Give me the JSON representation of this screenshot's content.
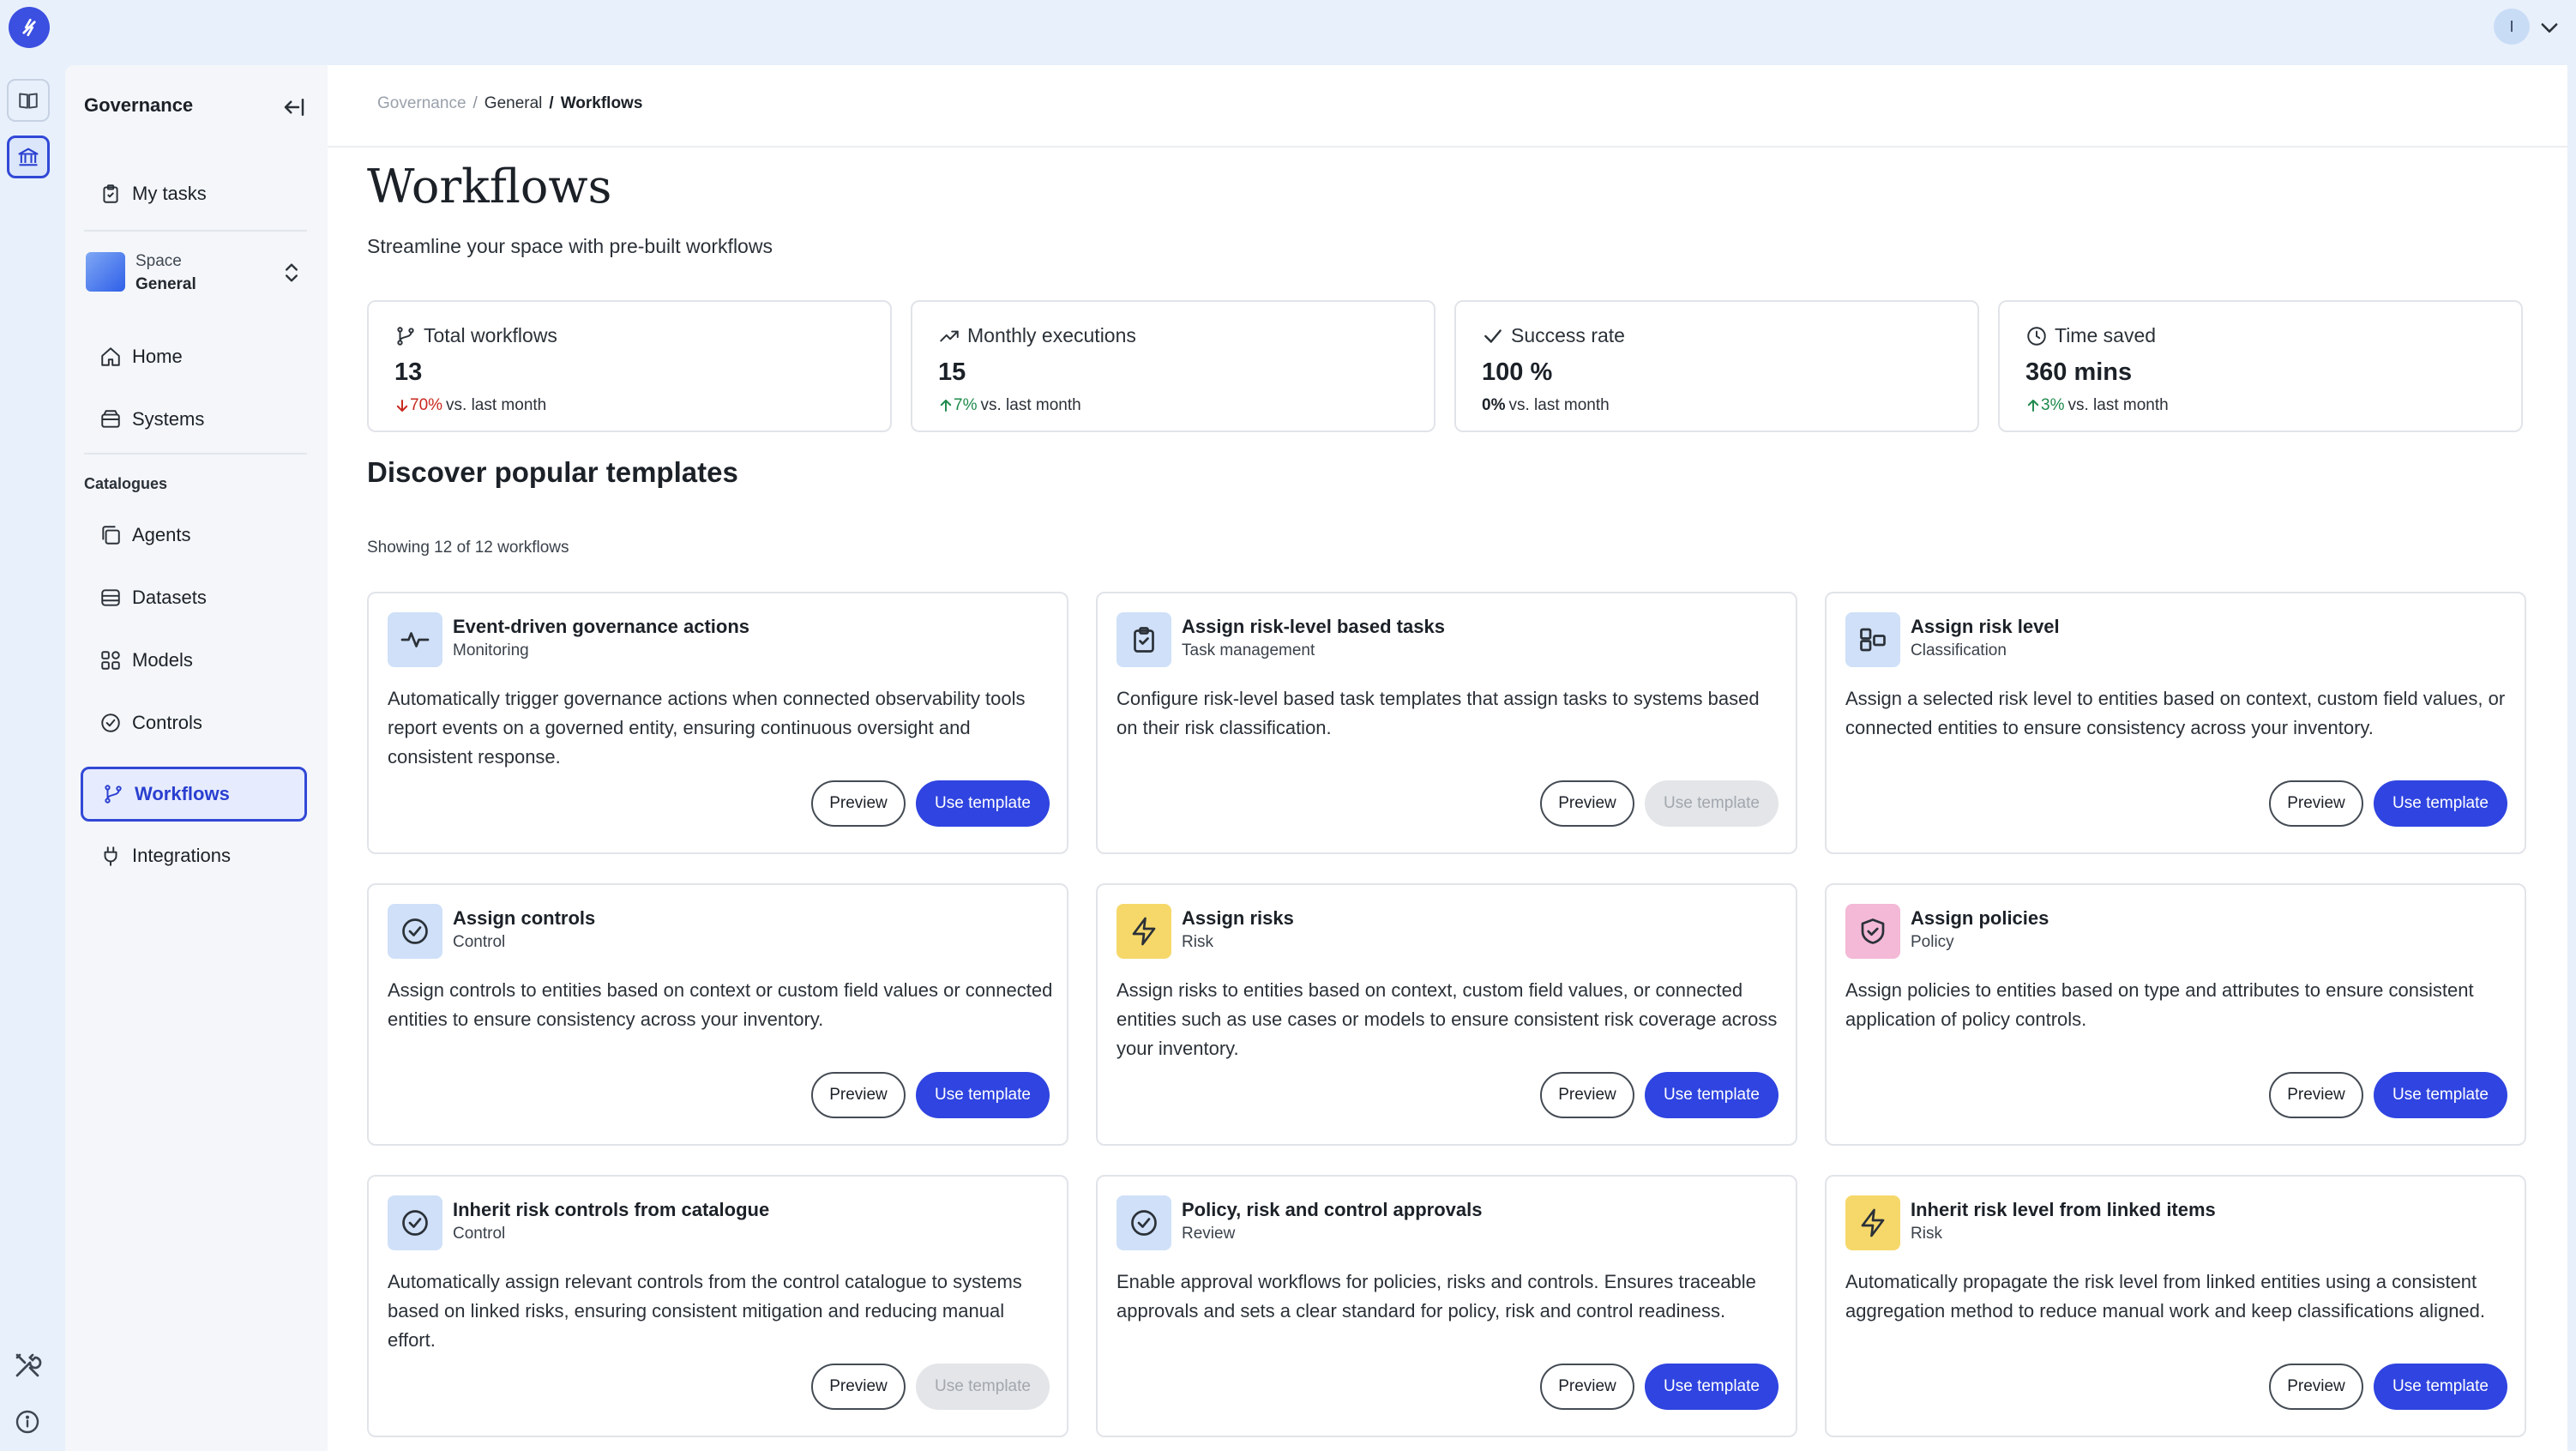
{
  "user": {
    "initial": "I"
  },
  "sidebar": {
    "title": "Governance",
    "my_tasks": "My tasks",
    "space_label": "Space",
    "space_name": "General",
    "home": "Home",
    "systems": "Systems",
    "catalogues_header": "Catalogues",
    "agents": "Agents",
    "datasets": "Datasets",
    "models": "Models",
    "controls": "Controls",
    "workflows": "Workflows",
    "integrations": "Integrations"
  },
  "breadcrumb": {
    "root": "Governance",
    "separator": "/",
    "mid": "General",
    "current": "Workflows"
  },
  "page": {
    "title": "Workflows",
    "subtitle": "Streamline your space with pre-built workflows"
  },
  "stats": [
    {
      "label": "Total workflows",
      "value": "13",
      "change": "70%",
      "direction": "down",
      "suffix": "vs. last month"
    },
    {
      "label": "Monthly executions",
      "value": "15",
      "change": "7%",
      "direction": "up",
      "suffix": "vs. last month"
    },
    {
      "label": "Success rate",
      "value": "100 %",
      "change": "0%",
      "direction": "flat",
      "suffix": "vs. last month"
    },
    {
      "label": "Time saved",
      "value": "360 mins",
      "change": "3%",
      "direction": "up",
      "suffix": "vs. last month"
    }
  ],
  "templates_section": {
    "title": "Discover popular templates",
    "showing": "Showing 12 of 12 workflows"
  },
  "buttons": {
    "preview": "Preview",
    "use": "Use template"
  },
  "colors": {
    "accent": "#2f44e0",
    "icon_blue": "#cfe0f8",
    "icon_yellow": "#f6d86a",
    "icon_pink": "#f3b9d6",
    "down": "#c8281e",
    "up": "#1e8a4c"
  },
  "templates": [
    {
      "title": "Event-driven governance actions",
      "category": "Monitoring",
      "icon": "pulse-icon",
      "icon_color": "blue",
      "description": "Automatically trigger governance actions when connected observability tools report events on a governed entity, ensuring continuous oversight and consistent response.",
      "use_enabled": true
    },
    {
      "title": "Assign risk-level based tasks",
      "category": "Task management",
      "icon": "clipboard-check-icon",
      "icon_color": "blue",
      "description": "Configure risk-level based task templates that assign tasks to systems based on their risk classification.",
      "use_enabled": false
    },
    {
      "title": "Assign risk level",
      "category": "Classification",
      "icon": "classification-icon",
      "icon_color": "blue",
      "description": "Assign a selected risk level to entities based on context, custom field values, or connected entities to ensure consistency across your inventory.",
      "use_enabled": true
    },
    {
      "title": "Assign controls",
      "category": "Control",
      "icon": "check-circle-icon",
      "icon_color": "blue",
      "description": "Assign controls to entities based on context or custom field values or connected entities to ensure consistency across your inventory.",
      "use_enabled": true
    },
    {
      "title": "Assign risks",
      "category": "Risk",
      "icon": "lightning-icon",
      "icon_color": "yellow",
      "description": "Assign risks to entities based on context, custom field values, or connected entities such as use cases or models to ensure consistent risk coverage across your inventory.",
      "use_enabled": true
    },
    {
      "title": "Assign policies",
      "category": "Policy",
      "icon": "shield-check-icon",
      "icon_color": "pink",
      "description": "Assign policies to entities based on type and attributes to ensure consistent application of policy controls.",
      "use_enabled": true
    },
    {
      "title": "Inherit risk controls from catalogue",
      "category": "Control",
      "icon": "check-circle-icon",
      "icon_color": "blue",
      "description": "Automatically assign relevant controls from the control catalogue to systems based on linked risks, ensuring consistent mitigation and reducing manual effort.",
      "use_enabled": false
    },
    {
      "title": "Policy, risk and control approvals",
      "category": "Review",
      "icon": "check-circle-icon",
      "icon_color": "blue",
      "description": "Enable approval workflows for policies, risks and controls. Ensures traceable approvals and sets a clear standard for policy, risk and control readiness.",
      "use_enabled": true
    },
    {
      "title": "Inherit risk level from linked items",
      "category": "Risk",
      "icon": "lightning-icon",
      "icon_color": "yellow",
      "description": "Automatically propagate the risk level from linked entities using a consistent aggregation method to reduce manual work and keep classifications aligned.",
      "use_enabled": true
    }
  ]
}
